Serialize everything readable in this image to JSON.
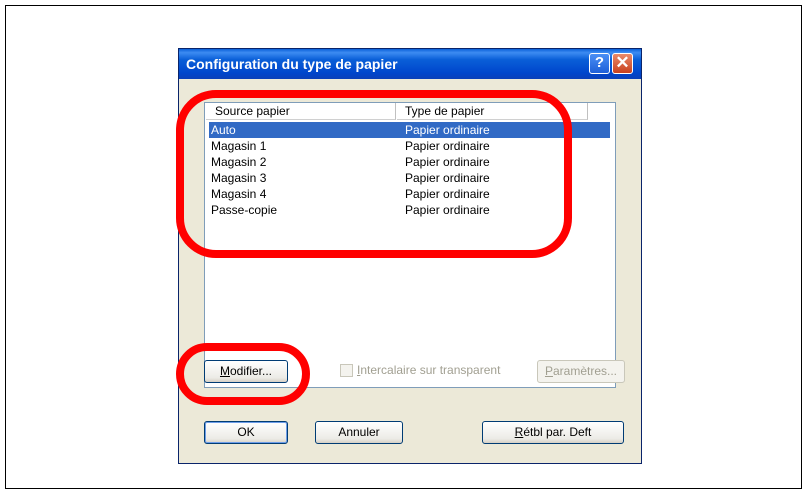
{
  "dialog": {
    "title": "Configuration du type de papier",
    "help_glyph": "?",
    "close_glyph": "✕"
  },
  "list": {
    "columns": [
      "Source papier",
      "Type de papier"
    ],
    "rows": [
      {
        "source": "Auto",
        "type": "Papier ordinaire",
        "selected": true
      },
      {
        "source": "Magasin 1",
        "type": "Papier ordinaire"
      },
      {
        "source": "Magasin 2",
        "type": "Papier ordinaire"
      },
      {
        "source": "Magasin 3",
        "type": "Papier ordinaire"
      },
      {
        "source": "Magasin 4",
        "type": "Papier ordinaire"
      },
      {
        "source": "Passe-copie",
        "type": "Papier ordinaire"
      }
    ]
  },
  "controls": {
    "modify_mnemonic": "M",
    "modify_rest": "odifier...",
    "interleave_mnemonic": "I",
    "interleave_rest": "ntercalaire sur transparent",
    "params_mnemonic": "P",
    "params_rest": "aramètres...",
    "ok_label": "OK",
    "cancel_label": "Annuler",
    "reset_mnemonic": "R",
    "reset_rest": "étbl par. Deft"
  },
  "colors": {
    "selection": "#316ac5",
    "highlight_oval": "#ff0000",
    "titlebar": "#0a5fd8"
  }
}
